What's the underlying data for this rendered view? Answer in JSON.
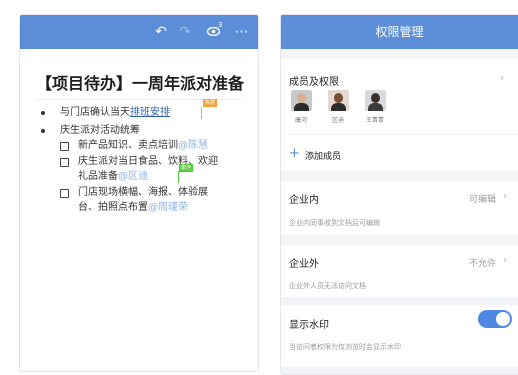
{
  "left": {
    "toolbar": {
      "undo_icon": "undo-icon",
      "redo_icon": "redo-icon",
      "eye_icon": "eye-icon",
      "viewer_count": "3",
      "more_icon": "more-icon"
    },
    "title": "【项目待办】一周年派对准备",
    "items": {
      "b1_text": "与门店确认当天",
      "b1_link": "排班安排",
      "b1_tag": "陈慧",
      "b2_text": "庆生派对活动统筹",
      "c1_text": "新产品知识、卖点培训",
      "c1_mention": "@陈慧",
      "c2_line1": "庆生派对当日食品、饮料、欢迎",
      "c2_line2": "礼品准备",
      "c2_mention": "@区迪",
      "c2_tag": "康河",
      "c3_line1": "门店现场横幅、海报、体验展",
      "c3_line2": "台、拍照点布置",
      "c3_mention": "@周瑾荣"
    }
  },
  "right": {
    "header_title": "权限管理",
    "members": {
      "label": "成员及权限",
      "people": [
        {
          "name": "康河",
          "skin": "#d8b093",
          "shirt": "#2b2b2b"
        },
        {
          "name": "区迪",
          "skin": "#c98f6f",
          "shirt": "#2c2c2c"
        },
        {
          "name": "王青青",
          "skin": "#d9b39c",
          "shirt": "#3a3a3a"
        }
      ],
      "add_label": "添加成员"
    },
    "internal": {
      "label": "企业内",
      "value": "可编辑",
      "desc": "企业内同事收到文档后可编辑"
    },
    "external": {
      "label": "企业外",
      "value": "不允许",
      "desc": "企业外人员无法访问文档"
    },
    "watermark": {
      "label": "显示水印",
      "enabled": true,
      "desc": "当访问者权限为仅浏览时会显示水印"
    },
    "colors": {
      "accent": "#5b8ed6",
      "toggle": "#4e88e5"
    }
  }
}
